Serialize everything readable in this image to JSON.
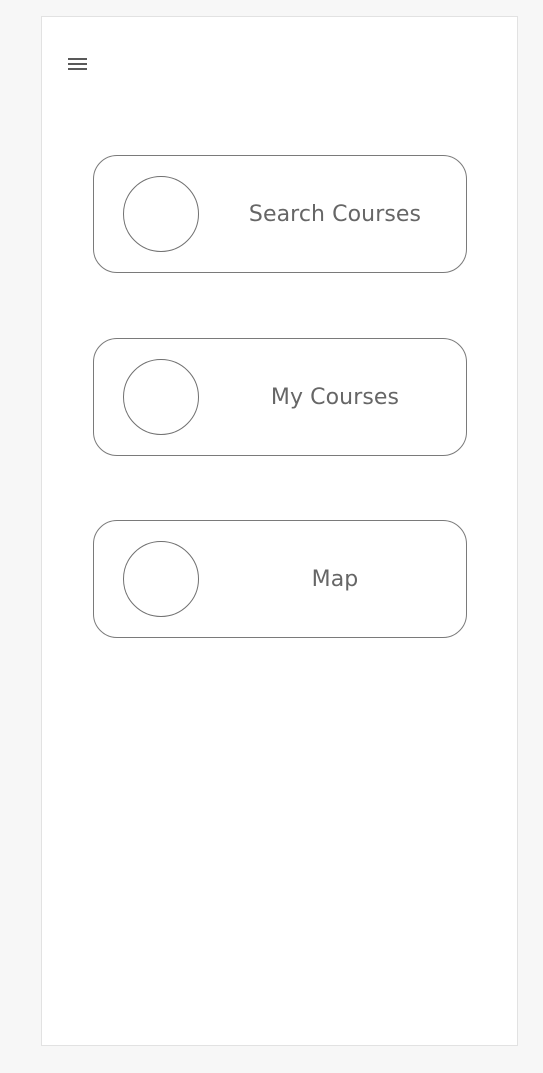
{
  "header": {
    "menu_icon": "hamburger-menu-icon"
  },
  "nav": {
    "items": [
      {
        "label": "Search Courses",
        "icon": "circle-placeholder-icon"
      },
      {
        "label": "My Courses",
        "icon": "circle-placeholder-icon"
      },
      {
        "label": "Map",
        "icon": "circle-placeholder-icon"
      }
    ]
  },
  "colors": {
    "background": "#f7f7f7",
    "screen": "#ffffff",
    "border": "#7a7a7a",
    "text": "#666666"
  }
}
